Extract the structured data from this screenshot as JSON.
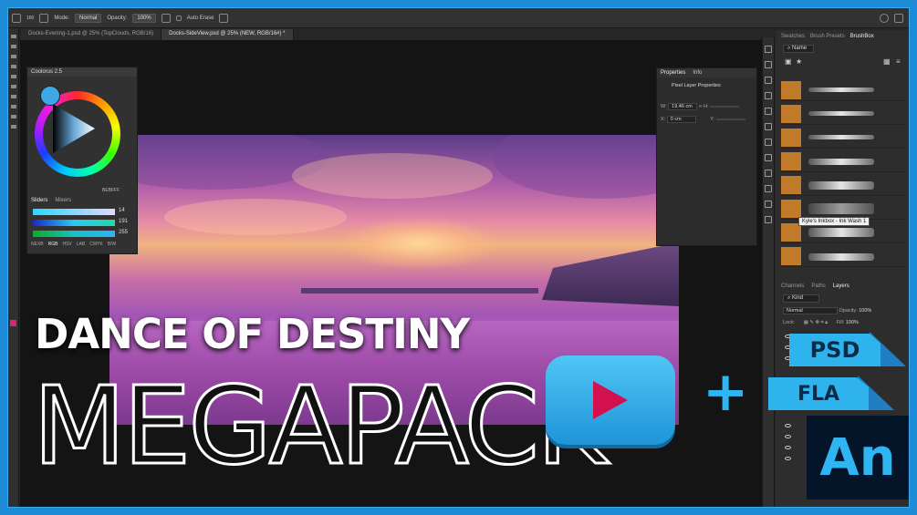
{
  "options_bar": {
    "mode_label": "Mode:",
    "mode_value": "Normal",
    "opacity_label": "Opacity:",
    "opacity_value": "100%",
    "auto_erase_label": "Auto Erase",
    "brush_size": "160"
  },
  "document_tabs": [
    {
      "label": "Docks-Evening-1.psd @ 25% (TopClouds, RGB/16)"
    },
    {
      "label": "Docks-SideView.psd @ 25% (NEW, RGB/16#) *"
    }
  ],
  "coolorus": {
    "title": "Coolorus 2.5",
    "hex": "BEBFFF",
    "tabs": [
      "Sliders",
      "Mixers"
    ],
    "slider_values": [
      "14",
      "191",
      "255"
    ],
    "modes": [
      "NEXB",
      "RGB",
      "HSV",
      "LAB",
      "CMYK",
      "B/W"
    ]
  },
  "properties": {
    "tabs": [
      "Properties",
      "Info"
    ],
    "heading": "Pixel Layer Properties",
    "w_label": "W:",
    "w_value": "19.46 cm",
    "h_label": "H:",
    "x_label": "X:",
    "x_value": "0 cm",
    "y_label": "Y:"
  },
  "brush_panel": {
    "tabs": [
      "Swatches",
      "Brush Presets",
      "BrushBox"
    ],
    "sort_value": "Name",
    "tooltip": "Kyle's Inkbox - Ink Wash 1"
  },
  "layers_panel": {
    "tabs": [
      "Channels",
      "Paths",
      "Layers"
    ],
    "kind_value": "Kind",
    "blend_value": "Normal",
    "opacity_label": "Opacity:",
    "opacity_value": "100%",
    "lock_label": "Lock:",
    "fill_label": "Fill:",
    "fill_value": "100%"
  },
  "overlay": {
    "title_line1": "DANCE OF DESTINY",
    "title_line2": "MEGAPACK",
    "plus": "+",
    "badge_psd": "PSD",
    "badge_fla": "FLA",
    "badge_an": "An"
  },
  "colors": {
    "frame_border": "#1e8bd6",
    "accent_blue": "#2fb3ec",
    "play_red": "#d4114f",
    "current_color": "#3ea7e8"
  }
}
